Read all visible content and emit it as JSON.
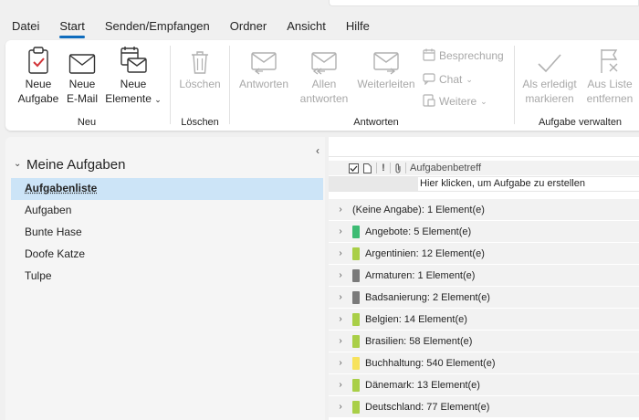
{
  "menu": {
    "tabs": [
      "Datei",
      "Start",
      "Senden/Empfangen",
      "Ordner",
      "Ansicht",
      "Hilfe"
    ],
    "active": "Start"
  },
  "ribbon": {
    "neu": {
      "label": "Neu",
      "neue_aufgabe": [
        "Neue",
        "Aufgabe"
      ],
      "neue_email": [
        "Neue",
        "E-Mail"
      ],
      "neue_elemente": [
        "Neue",
        "Elemente"
      ]
    },
    "loeschen": {
      "label": "Löschen",
      "button": "Löschen"
    },
    "antworten": {
      "label": "Antworten",
      "antworten": "Antworten",
      "allen_antworten": [
        "Allen",
        "antworten"
      ],
      "weiterleiten": "Weiterleiten",
      "besprechung": "Besprechung",
      "chat": "Chat",
      "weitere": "Weitere"
    },
    "aufgabe_verwalten": {
      "label": "Aufgabe verwalten",
      "als_erledigt": [
        "Als erledigt",
        "markieren"
      ],
      "aus_liste": [
        "Aus Liste",
        "entfernen"
      ]
    }
  },
  "sidebar": {
    "root": "Meine Aufgaben",
    "items": [
      "Aufgabenliste",
      "Aufgaben",
      "Bunte Hase",
      "Doofe Katze",
      "Tulpe"
    ],
    "selected_index": 0
  },
  "tasklist": {
    "column_subject": "Aufgabenbetreff",
    "new_task_placeholder": "Hier klicken, um Aufgabe zu erstellen",
    "groups": [
      {
        "label": "(Keine Angabe): 1 Element(e)",
        "color": ""
      },
      {
        "label": "Angebote: 5 Element(e)",
        "color": "#3dbb73"
      },
      {
        "label": "Argentinien: 12 Element(e)",
        "color": "#a9cf47"
      },
      {
        "label": "Armaturen: 1 Element(e)",
        "color": "#7a7a7a"
      },
      {
        "label": "Badsanierung: 2 Element(e)",
        "color": "#7a7a7a"
      },
      {
        "label": "Belgien: 14 Element(e)",
        "color": "#a9cf47"
      },
      {
        "label": "Brasilien: 58 Element(e)",
        "color": "#a9cf47"
      },
      {
        "label": "Buchhaltung: 540 Element(e)",
        "color": "#f7e25c"
      },
      {
        "label": "Dänemark: 13 Element(e)",
        "color": "#a9cf47"
      },
      {
        "label": "Deutschland: 77 Element(e)",
        "color": "#a9cf47"
      }
    ]
  }
}
